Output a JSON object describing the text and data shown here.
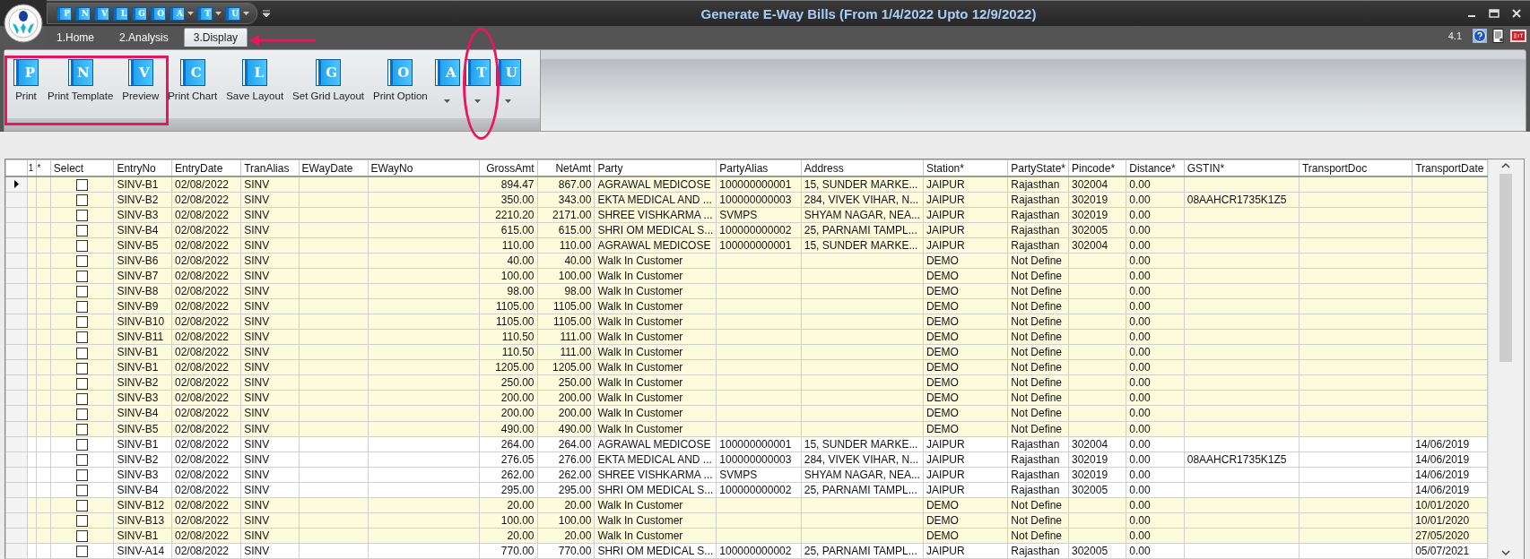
{
  "window": {
    "title": "Generate E-Way Bills (From 1/4/2022 Upto 12/9/2022)"
  },
  "quick_access": [
    {
      "letter": "P",
      "dropdown": false
    },
    {
      "letter": "N",
      "dropdown": false
    },
    {
      "letter": "V",
      "dropdown": false
    },
    {
      "letter": "L",
      "dropdown": false
    },
    {
      "letter": "G",
      "dropdown": false
    },
    {
      "letter": "O",
      "dropdown": false
    },
    {
      "letter": "A",
      "dropdown": true
    },
    {
      "letter": "T",
      "dropdown": true
    },
    {
      "letter": "U",
      "dropdown": true
    }
  ],
  "tabs": [
    {
      "label": "1.Home",
      "selected": false
    },
    {
      "label": "2.Analysis",
      "selected": false
    },
    {
      "label": "3.Display",
      "selected": true
    }
  ],
  "version": "4.1",
  "ribbon": [
    {
      "letter": "P",
      "label": "Print",
      "dropdown": false
    },
    {
      "letter": "N",
      "label": "Print Template",
      "dropdown": false
    },
    {
      "letter": "V",
      "label": "Preview",
      "dropdown": false
    },
    {
      "letter": "C",
      "label": "Print Chart",
      "dropdown": false
    },
    {
      "letter": "L",
      "label": "Save Layout",
      "dropdown": false
    },
    {
      "letter": "G",
      "label": "Set Grid Layout",
      "dropdown": false
    },
    {
      "letter": "O",
      "label": "Print Option",
      "dropdown": false
    },
    {
      "letter": "A",
      "dropdown": true
    },
    {
      "letter": "T",
      "dropdown": true
    },
    {
      "letter": "U",
      "dropdown": true
    }
  ],
  "table": {
    "columns": [
      {
        "label": "1",
        "kind": "index"
      },
      {
        "label": "*",
        "kind": "flag"
      },
      {
        "label": "Select",
        "kind": "check"
      },
      {
        "label": "EntryNo",
        "kind": "text"
      },
      {
        "label": "EntryDate",
        "kind": "text"
      },
      {
        "label": "TranAlias",
        "kind": "text"
      },
      {
        "label": "EWayDate",
        "kind": "text"
      },
      {
        "label": "EWayNo",
        "kind": "text"
      },
      {
        "label": "GrossAmt",
        "kind": "number"
      },
      {
        "label": "NetAmt",
        "kind": "number"
      },
      {
        "label": "Party",
        "kind": "text"
      },
      {
        "label": "PartyAlias",
        "kind": "text"
      },
      {
        "label": "Address",
        "kind": "text"
      },
      {
        "label": "Station*",
        "kind": "text"
      },
      {
        "label": "PartyState*",
        "kind": "text"
      },
      {
        "label": "Pincode*",
        "kind": "text"
      },
      {
        "label": "Distance*",
        "kind": "text"
      },
      {
        "label": "GSTIN*",
        "kind": "text"
      },
      {
        "label": "TransportDoc",
        "kind": "text"
      },
      {
        "label": "TransportDate",
        "kind": "text"
      }
    ],
    "rows": [
      {
        "selected": true,
        "highlighted": true,
        "checked": false,
        "cells": [
          null,
          null,
          null,
          "SINV-B1",
          "02/08/2022",
          "SINV",
          null,
          null,
          "894.47",
          "867.00",
          "AGRAWAL MEDICOSE",
          "100000000001",
          "15, SUNDER MARKE...",
          "JAIPUR",
          "Rajasthan",
          "302004",
          "0.00",
          null,
          null,
          null
        ]
      },
      {
        "selected": false,
        "highlighted": true,
        "checked": false,
        "cells": [
          null,
          null,
          null,
          "SINV-B2",
          "02/08/2022",
          "SINV",
          null,
          null,
          "350.00",
          "343.00",
          "EKTA MEDICAL AND ...",
          "100000000003",
          "284, VIVEK VIHAR, N...",
          "JAIPUR",
          "Rajasthan",
          "302019",
          "0.00",
          "08AAHCR1735K1Z5",
          null,
          null
        ]
      },
      {
        "selected": false,
        "highlighted": true,
        "checked": false,
        "cells": [
          null,
          null,
          null,
          "SINV-B3",
          "02/08/2022",
          "SINV",
          null,
          null,
          "2210.20",
          "2171.00",
          "SHREE VISHKARMA ...",
          "SVMPS",
          "SHYAM NAGAR, NEA...",
          "JAIPUR",
          "Rajasthan",
          "302019",
          "0.00",
          null,
          null,
          null
        ]
      },
      {
        "selected": false,
        "highlighted": true,
        "checked": false,
        "cells": [
          null,
          null,
          null,
          "SINV-B4",
          "02/08/2022",
          "SINV",
          null,
          null,
          "615.00",
          "615.00",
          "SHRI OM MEDICAL S...",
          "100000000002",
          "25, PARNAMI TAMPL...",
          "JAIPUR",
          "Rajasthan",
          "302005",
          "0.00",
          null,
          null,
          null
        ]
      },
      {
        "selected": false,
        "highlighted": true,
        "checked": false,
        "cells": [
          null,
          null,
          null,
          "SINV-B5",
          "02/08/2022",
          "SINV",
          null,
          null,
          "110.00",
          "110.00",
          "AGRAWAL MEDICOSE",
          "100000000001",
          "15, SUNDER MARKE...",
          "JAIPUR",
          "Rajasthan",
          "302004",
          "0.00",
          null,
          null,
          null
        ]
      },
      {
        "selected": false,
        "highlighted": true,
        "checked": false,
        "cells": [
          null,
          null,
          null,
          "SINV-B6",
          "02/08/2022",
          "SINV",
          null,
          null,
          "40.00",
          "40.00",
          "Walk In Customer",
          null,
          null,
          "DEMO",
          "Not Define",
          null,
          "0.00",
          null,
          null,
          null
        ]
      },
      {
        "selected": false,
        "highlighted": true,
        "checked": false,
        "cells": [
          null,
          null,
          null,
          "SINV-B7",
          "02/08/2022",
          "SINV",
          null,
          null,
          "100.00",
          "100.00",
          "Walk In Customer",
          null,
          null,
          "DEMO",
          "Not Define",
          null,
          "0.00",
          null,
          null,
          null
        ]
      },
      {
        "selected": false,
        "highlighted": true,
        "checked": false,
        "cells": [
          null,
          null,
          null,
          "SINV-B8",
          "02/08/2022",
          "SINV",
          null,
          null,
          "98.00",
          "98.00",
          "Walk In Customer",
          null,
          null,
          "DEMO",
          "Not Define",
          null,
          "0.00",
          null,
          null,
          null
        ]
      },
      {
        "selected": false,
        "highlighted": true,
        "checked": false,
        "cells": [
          null,
          null,
          null,
          "SINV-B9",
          "02/08/2022",
          "SINV",
          null,
          null,
          "1105.00",
          "1105.00",
          "Walk In Customer",
          null,
          null,
          "DEMO",
          "Not Define",
          null,
          "0.00",
          null,
          null,
          null
        ]
      },
      {
        "selected": false,
        "highlighted": true,
        "checked": false,
        "cells": [
          null,
          null,
          null,
          "SINV-B10",
          "02/08/2022",
          "SINV",
          null,
          null,
          "1105.00",
          "1105.00",
          "Walk In Customer",
          null,
          null,
          "DEMO",
          "Not Define",
          null,
          "0.00",
          null,
          null,
          null
        ]
      },
      {
        "selected": false,
        "highlighted": true,
        "checked": false,
        "cells": [
          null,
          null,
          null,
          "SINV-B11",
          "02/08/2022",
          "SINV",
          null,
          null,
          "110.50",
          "111.00",
          "Walk In Customer",
          null,
          null,
          "DEMO",
          "Not Define",
          null,
          "0.00",
          null,
          null,
          null
        ]
      },
      {
        "selected": false,
        "highlighted": true,
        "checked": false,
        "cells": [
          null,
          null,
          null,
          "SINV-B1",
          "02/08/2022",
          "SINV",
          null,
          null,
          "110.50",
          "111.00",
          "Walk In Customer",
          null,
          null,
          "DEMO",
          "Not Define",
          null,
          "0.00",
          null,
          null,
          null
        ]
      },
      {
        "selected": false,
        "highlighted": true,
        "checked": false,
        "cells": [
          null,
          null,
          null,
          "SINV-B1",
          "02/08/2022",
          "SINV",
          null,
          null,
          "1205.00",
          "1205.00",
          "Walk In Customer",
          null,
          null,
          "DEMO",
          "Not Define",
          null,
          "0.00",
          null,
          null,
          null
        ]
      },
      {
        "selected": false,
        "highlighted": true,
        "checked": false,
        "cells": [
          null,
          null,
          null,
          "SINV-B2",
          "02/08/2022",
          "SINV",
          null,
          null,
          "250.00",
          "250.00",
          "Walk In Customer",
          null,
          null,
          "DEMO",
          "Not Define",
          null,
          "0.00",
          null,
          null,
          null
        ]
      },
      {
        "selected": false,
        "highlighted": true,
        "checked": false,
        "cells": [
          null,
          null,
          null,
          "SINV-B3",
          "02/08/2022",
          "SINV",
          null,
          null,
          "200.00",
          "200.00",
          "Walk In Customer",
          null,
          null,
          "DEMO",
          "Not Define",
          null,
          "0.00",
          null,
          null,
          null
        ]
      },
      {
        "selected": false,
        "highlighted": true,
        "checked": false,
        "cells": [
          null,
          null,
          null,
          "SINV-B4",
          "02/08/2022",
          "SINV",
          null,
          null,
          "200.00",
          "200.00",
          "Walk In Customer",
          null,
          null,
          "DEMO",
          "Not Define",
          null,
          "0.00",
          null,
          null,
          null
        ]
      },
      {
        "selected": false,
        "highlighted": true,
        "checked": false,
        "cells": [
          null,
          null,
          null,
          "SINV-B5",
          "02/08/2022",
          "SINV",
          null,
          null,
          "490.00",
          "490.00",
          "Walk In Customer",
          null,
          null,
          "DEMO",
          "Not Define",
          null,
          "0.00",
          null,
          null,
          null
        ]
      },
      {
        "selected": false,
        "highlighted": false,
        "checked": false,
        "cells": [
          null,
          null,
          null,
          "SINV-B1",
          "02/08/2022",
          "SINV",
          null,
          null,
          "264.00",
          "264.00",
          "AGRAWAL MEDICOSE",
          "100000000001",
          "15, SUNDER MARKE...",
          "JAIPUR",
          "Rajasthan",
          "302004",
          "0.00",
          null,
          null,
          "14/06/2019"
        ]
      },
      {
        "selected": false,
        "highlighted": false,
        "checked": false,
        "cells": [
          null,
          null,
          null,
          "SINV-B2",
          "02/08/2022",
          "SINV",
          null,
          null,
          "276.05",
          "276.00",
          "EKTA MEDICAL AND ...",
          "100000000003",
          "284, VIVEK VIHAR, N...",
          "JAIPUR",
          "Rajasthan",
          "302019",
          "0.00",
          "08AAHCR1735K1Z5",
          null,
          "14/06/2019"
        ]
      },
      {
        "selected": false,
        "highlighted": false,
        "checked": false,
        "cells": [
          null,
          null,
          null,
          "SINV-B3",
          "02/08/2022",
          "SINV",
          null,
          null,
          "262.00",
          "262.00",
          "SHREE VISHKARMA ...",
          "SVMPS",
          "SHYAM NAGAR, NEA...",
          "JAIPUR",
          "Rajasthan",
          "302019",
          "0.00",
          null,
          null,
          "14/06/2019"
        ]
      },
      {
        "selected": false,
        "highlighted": false,
        "checked": false,
        "cells": [
          null,
          null,
          null,
          "SINV-B4",
          "02/08/2022",
          "SINV",
          null,
          null,
          "295.00",
          "295.00",
          "SHRI OM MEDICAL S...",
          "100000000002",
          "25, PARNAMI TAMPL...",
          "JAIPUR",
          "Rajasthan",
          "302005",
          "0.00",
          null,
          null,
          "14/06/2019"
        ]
      },
      {
        "selected": false,
        "highlighted": true,
        "checked": false,
        "cells": [
          null,
          null,
          null,
          "SINV-B12",
          "02/08/2022",
          "SINV",
          null,
          null,
          "20.00",
          "20.00",
          "Walk In Customer",
          null,
          null,
          "DEMO",
          "Not Define",
          null,
          "0.00",
          null,
          null,
          "10/01/2020"
        ]
      },
      {
        "selected": false,
        "highlighted": true,
        "checked": false,
        "cells": [
          null,
          null,
          null,
          "SINV-B13",
          "02/08/2022",
          "SINV",
          null,
          null,
          "100.00",
          "100.00",
          "Walk In Customer",
          null,
          null,
          "DEMO",
          "Not Define",
          null,
          "0.00",
          null,
          null,
          "10/01/2020"
        ]
      },
      {
        "selected": false,
        "highlighted": true,
        "checked": false,
        "cells": [
          null,
          null,
          null,
          "SINV-B1",
          "02/08/2022",
          "SINV",
          null,
          null,
          "20.00",
          "20.00",
          "Walk In Customer",
          null,
          null,
          "DEMO",
          "Not Define",
          null,
          "0.00",
          null,
          null,
          "27/05/2020"
        ]
      },
      {
        "selected": false,
        "highlighted": false,
        "checked": false,
        "cells": [
          null,
          null,
          null,
          "SINV-A14",
          "02/08/2022",
          "SINV",
          null,
          null,
          "770.00",
          "770.00",
          "SHRI OM MEDICAL S...",
          "100000000002",
          "25, PARNAMI TAMPL...",
          "JAIPUR",
          "Rajasthan",
          "302005",
          "0.00",
          null,
          null,
          "05/07/2021"
        ]
      }
    ]
  }
}
